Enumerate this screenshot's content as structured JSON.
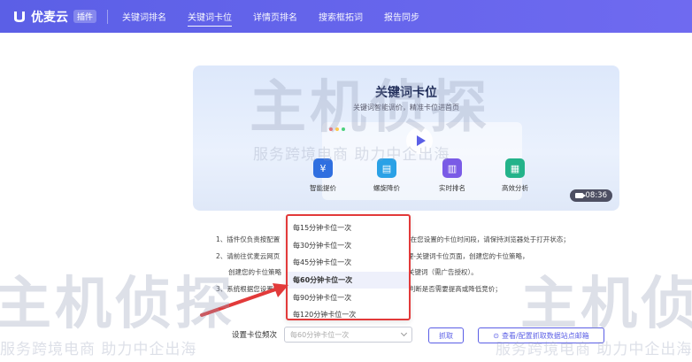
{
  "nav": {
    "brand": "优麦云",
    "badge": "插件",
    "tabs": [
      {
        "label": "关键词排名",
        "active": false
      },
      {
        "label": "关键词卡位",
        "active": true
      },
      {
        "label": "详情页排名",
        "active": false
      },
      {
        "label": "搜索框拓词",
        "active": false
      },
      {
        "label": "报告同步",
        "active": false
      }
    ]
  },
  "banner": {
    "title": "关键词卡位",
    "subtitle": "关键词智能调价，精准卡位进首页",
    "features": [
      {
        "label": "智能提价",
        "icon": "smart-bid-icon",
        "color": "#2f6fe0"
      },
      {
        "label": "螺旋降价",
        "icon": "spiral-price-icon",
        "color": "#2aa1e6"
      },
      {
        "label": "实时排名",
        "icon": "realtime-rank-icon",
        "color": "#7a5be6"
      },
      {
        "label": "高效分析",
        "icon": "analysis-icon",
        "color": "#23b38a"
      }
    ],
    "duration": "08:36"
  },
  "notes": [
    "1、插件仅负责按配置",
    "2、请前往优麦云网页",
    "创建您的卡位策略",
    "3、系统根据您设置的"
  ],
  "notes_right": [
    "，在您设置的卡位时间段，请保持浏览器处于打开状态；",
    "管理-关键词卡位页面，创建您的卡位策略，",
    "卡位关键词（需广告授权）。",
    "投放状态，判断是否需要提高或降低竞价；"
  ],
  "frequency": {
    "label": "设置卡位频次",
    "placeholder": "每60分钟卡位一次",
    "options": [
      {
        "label": "每15分钟卡位一次",
        "selected": false
      },
      {
        "label": "每30分钟卡位一次",
        "selected": false
      },
      {
        "label": "每45分钟卡位一次",
        "selected": false
      },
      {
        "label": "每60分钟卡位一次",
        "selected": true
      },
      {
        "label": "每90分钟卡位一次",
        "selected": false
      },
      {
        "label": "每120分钟卡位一次",
        "selected": false
      }
    ]
  },
  "buttons": {
    "grab": "抓取",
    "config": "查看/配置抓取数据站点邮箱"
  },
  "watermark": {
    "big": "主机侦探",
    "small": "服务跨境电商 助力中企出海"
  },
  "colors": {
    "accent": "#5b5fe6",
    "highlight": "#e23a3a"
  }
}
